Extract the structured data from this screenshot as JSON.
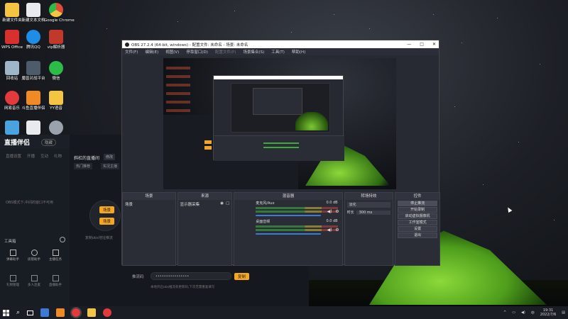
{
  "desktop": {
    "icons": [
      {
        "label": "新建文件夹",
        "color": "#f4c542"
      },
      {
        "label": "新建文本文档",
        "color": "#e8eaf0"
      },
      {
        "label": "Google Chrome",
        "color": "#e04b3a"
      },
      {
        "label": "WPS Office",
        "color": "#d8302e"
      },
      {
        "label": "腾讯QQ",
        "color": "#1f8ce6"
      },
      {
        "label": "vip解析器",
        "color": "#c0392b"
      },
      {
        "label": "回收站",
        "color": "#9fb6c9"
      },
      {
        "label": "魔兽对战平台",
        "color": "#4e5b6a"
      },
      {
        "label": "微信",
        "color": "#2dbb4a"
      },
      {
        "label": "网易音乐",
        "color": "#e33b3b"
      },
      {
        "label": "斗鱼直播伴侣",
        "color": "#f08a24"
      },
      {
        "label": "YY语音",
        "color": "#f4c542"
      },
      {
        "label": "",
        "color": "#4aa3df"
      },
      {
        "label": "",
        "color": "#e8eaf0"
      },
      {
        "label": "",
        "color": "#9aa3ad"
      }
    ]
  },
  "streamer_app": {
    "logo": "直播伴侣",
    "pill": "隐藏",
    "tabs": [
      "直播设置",
      "开播",
      "互动",
      "礼物"
    ],
    "channel_label": "斜杠的直播间",
    "channel_btn": "修改",
    "tags": [
      "热门推荐",
      "实况主播"
    ],
    "empty_hint": "OBS模式下,中间的窗口不可用",
    "scene_btn_1": "场景",
    "scene_btn_2": "场景",
    "toolbox_title": "工具箱",
    "tools": [
      "弹幕助手",
      "房管助手",
      "主播任务",
      "礼物管理",
      "多人连麦",
      "直播助手"
    ],
    "password_label": "推流码",
    "password_value": "••••••••••••••••",
    "copy_btn": "复制",
    "hint": "本地开启obs推流有更新码,下次无需重复填写",
    "bottom_hint": "复制obs地址推流"
  },
  "obs": {
    "title": "OBS 27.2.4 (64-bit, windows) - 配置文件: 未命名 - 场景: 未命名",
    "window_controls": [
      "—",
      "□",
      "✕"
    ],
    "menu": [
      "文件(F)",
      "编辑(E)",
      "视图(V)",
      "停靠窗口(D)",
      "配置文件(P)",
      "场景集合(S)",
      "工具(T)",
      "帮助(H)"
    ],
    "docks": {
      "scenes": {
        "title": "场景",
        "items": [
          "场景"
        ]
      },
      "sources": {
        "title": "来源",
        "items": [
          "显示器采集"
        ]
      },
      "mixer": {
        "title": "混音器",
        "channels": [
          {
            "name": "麦克风/Aux",
            "db": "0.0 dB"
          },
          {
            "name": "桌面音频",
            "db": "0.0 dB"
          }
        ]
      },
      "transitions": {
        "title": "转场特效",
        "type": "淡化",
        "duration_label": "时长",
        "duration_value": "300 ms"
      },
      "controls": {
        "title": "控件",
        "buttons": [
          "停止推流",
          "开始录制",
          "启动虚拟摄像机",
          "工作室模式",
          "设置",
          "退出"
        ]
      }
    }
  },
  "taskbar": {
    "time": "19:31",
    "date": "2022/7/6",
    "apps": [
      "#3b7bd6",
      "#f08a24",
      "#e33b3b",
      "#f4c542",
      "#e33b3b"
    ]
  }
}
